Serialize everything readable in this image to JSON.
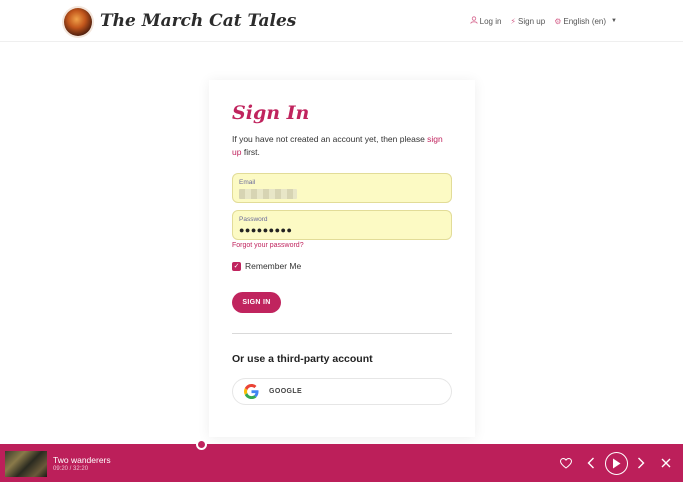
{
  "header": {
    "site_title": "The March Cat Tales",
    "nav": {
      "login": "Log in",
      "signup": "Sign up",
      "language": "English (en)"
    }
  },
  "signin": {
    "title": "Sign In",
    "intro_prefix": "If you have not created an account yet, then please ",
    "intro_link": "sign up",
    "intro_suffix": " first.",
    "email_label": "Email",
    "password_label": "Password",
    "password_value": "●●●●●●●●●",
    "forgot_link": "Forgot your password?",
    "remember_label": "Remember Me",
    "remember_checked": true,
    "submit_label": "SIGN IN",
    "third_party_heading": "Or use a third-party account",
    "google_label": "GOOGLE"
  },
  "player": {
    "track_title": "Two wanderers",
    "time": "09:20 / 32:20",
    "progress": 0.29,
    "accent_color": "#bc1f5a"
  },
  "colors": {
    "accent": "#c0245e",
    "field_bg": "#fcfac4"
  }
}
